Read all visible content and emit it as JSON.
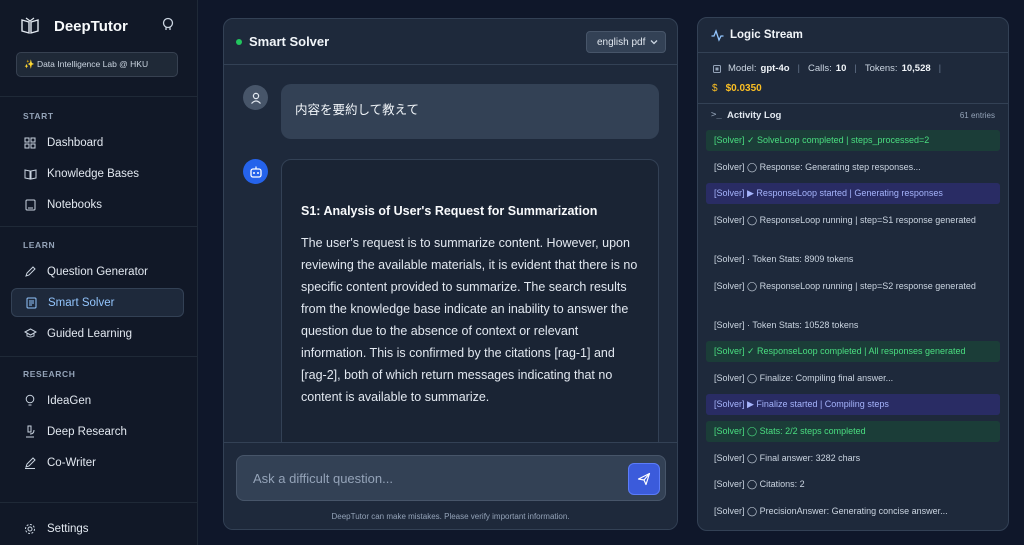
{
  "sidebar": {
    "brand": "DeepTutor",
    "lab_badge": "✨ Data Intelligence Lab @ HKU",
    "sections": {
      "start": "START",
      "learn": "LEARN",
      "research": "RESEARCH"
    },
    "items": {
      "dashboard": "Dashboard",
      "knowledge_bases": "Knowledge Bases",
      "notebooks": "Notebooks",
      "question_generator": "Question Generator",
      "smart_solver": "Smart Solver",
      "guided_learning": "Guided Learning",
      "ideagen": "IdeaGen",
      "deep_research": "Deep Research",
      "co_writer": "Co-Writer",
      "settings": "Settings"
    }
  },
  "chat": {
    "title": "Smart Solver",
    "kb_selected": "english pdf",
    "user_message": "内容を要約して教えて",
    "bot_heading": "S1: Analysis of User's Request for Summarization",
    "bot_text": "The user's request is to summarize content. However, upon reviewing the available materials, it is evident that there is no specific content provided to summarize. The search results from the knowledge base indicate an inability to answer the question due to the absence of context or relevant information. This is confirmed by the citations [rag-1] and [rag-2], both of which return messages indicating that no content is available to summarize.",
    "input_placeholder": "Ask a difficult question...",
    "disclaimer": "DeepTutor can make mistakes. Please verify important information."
  },
  "logic": {
    "title": "Logic Stream",
    "model_label": "Model:",
    "model_value": "gpt-4o",
    "calls_label": "Calls:",
    "calls_value": "10",
    "tokens_label": "Tokens:",
    "tokens_value": "10,528",
    "cost": "$0.0350",
    "log_title": "Activity Log",
    "log_count": "61 entries",
    "entries": [
      "[Solver] ✓ SolveLoop completed | steps_processed=2",
      "[Solver] ◯ Response: Generating step responses...",
      "[Solver] ▶ ResponseLoop started | Generating responses",
      "[Solver] ◯ ResponseLoop running | step=S1 response generated",
      "[Solver] · Token Stats: 8909 tokens",
      "[Solver] ◯ ResponseLoop running | step=S2 response generated",
      "[Solver] · Token Stats: 10528 tokens",
      "[Solver] ✓ ResponseLoop completed | All responses generated",
      "[Solver] ◯ Finalize: Compiling final answer...",
      "[Solver] ▶ Finalize started | Compiling steps",
      "[Solver] ◯ Stats: 2/2 steps completed",
      "[Solver] ◯ Final answer: 3282 chars",
      "[Solver] ◯ Citations: 2",
      "[Solver] ◯ PrecisionAnswer: Generating concise answer..."
    ]
  },
  "colors": {
    "accent": "#2563eb",
    "success": "#4ade80",
    "info": "#a5b4fc",
    "cost": "#fbbf24"
  }
}
